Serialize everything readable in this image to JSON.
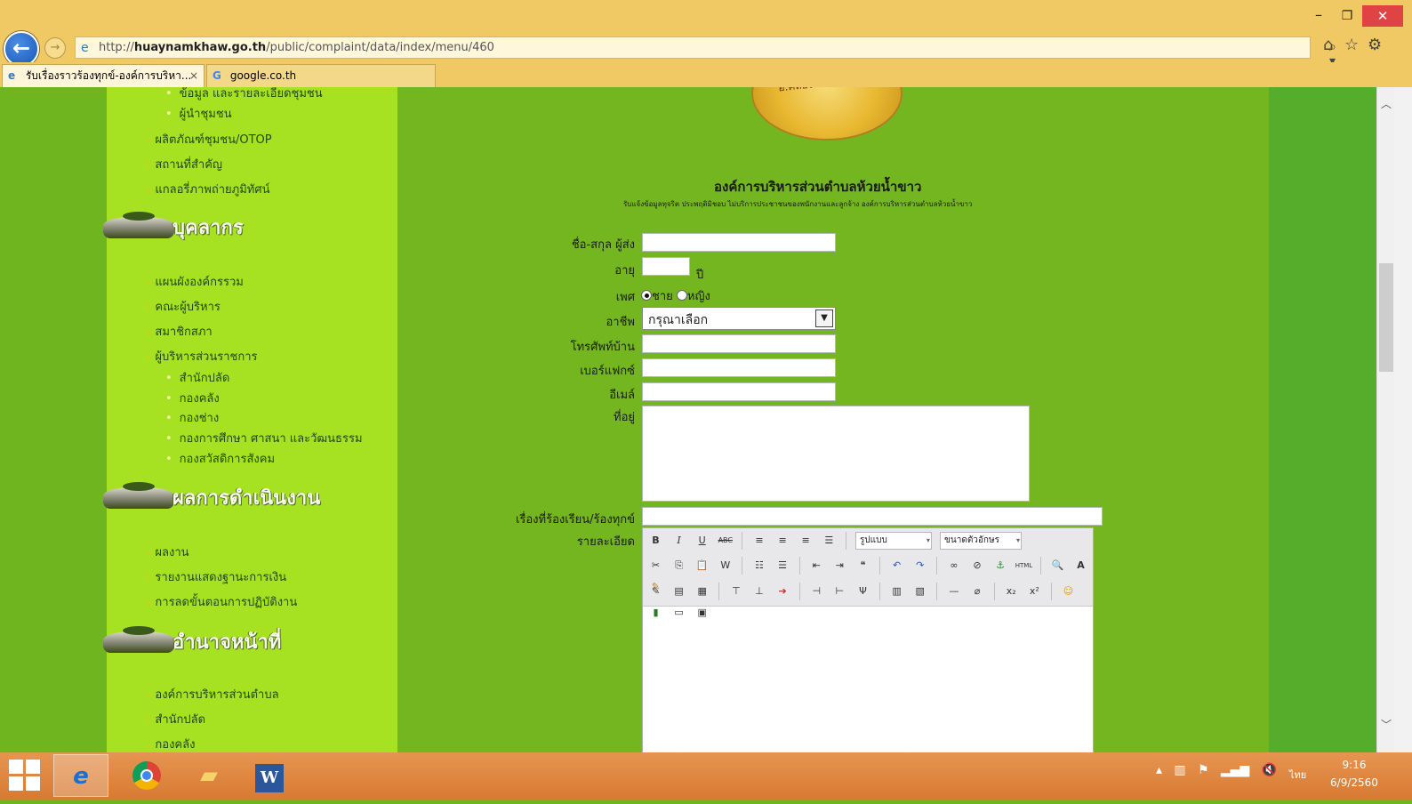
{
  "browser": {
    "url_prefix": "http://",
    "url_domain": "huaynamkhaw.go.th",
    "url_path": "/public/complaint/data/index/menu/460",
    "tabs": [
      {
        "label": "รับเรื่องราวร้องทุกข์-องค์การบริหา..."
      },
      {
        "label": "google.co.th"
      }
    ],
    "close_symbol": "×"
  },
  "sidebar": {
    "top_items": [
      "ข้อมูล และรายละเอียดชุมชน",
      "ผู้นำชุมชน"
    ],
    "group1": [
      "ผลิตภัณฑ์ชุมชน/OTOP",
      "สถานที่สำคัญ",
      "แกลอรี่ภาพถ่ายภูมิทัศน์"
    ],
    "header_personnel": "บุคลากร",
    "personnel": [
      "แผนผังองค์กรรวม",
      "คณะผู้บริหาร",
      "สมาชิกสภา",
      "ผู้บริหารส่วนราชการ"
    ],
    "personnel_sub": [
      "สำนักปลัด",
      "กองคลัง",
      "กองช่าง",
      "กองการศึกษา ศาสนา และวัฒนธรรม",
      "กองสวัสดิการสังคม"
    ],
    "header_results": "ผลการดำเนินงาน",
    "results": [
      "ผลงาน",
      "รายงานแสดงฐานะการเงิน",
      "การลดขั้นตอนการปฏิบัติงาน"
    ],
    "header_authority": "อำนาจหน้าที่",
    "authority": [
      "องค์การบริหารส่วนตำบล",
      "สำนักปลัด",
      "กองคลัง"
    ]
  },
  "content": {
    "seal_text": "อ.คลองท่อม จ.กระบี่",
    "title": "องค์การบริหารส่วนตำบลห้วยน้ำขาว",
    "subtitle": "รับแจ้งข้อมูลทุจริต ประพฤติมิชอบ ไม่บริการประชาชนของพนักงานและลูกจ้าง องค์การบริหารส่วนตำบลห้วยน้ำขาว",
    "form": {
      "name_label": "ชื่อ-สกุล ผู้ส่ง",
      "age_label": "อายุ",
      "age_unit": "ปี",
      "gender_label": "เพศ",
      "gender_male": "ชาย",
      "gender_female": "หญิง",
      "occupation_label": "อาชีพ",
      "occupation_value": "กรุณาเลือก",
      "phone_label": "โทรศัพท์บ้าน",
      "fax_label": "เบอร์แฟกซ์",
      "email_label": "อีเมล์",
      "address_label": "ที่อยู่",
      "subject_label": "เรื่องที่ร้องเรียน/ร้องทุกข์",
      "detail_label": "รายละเอียด"
    },
    "editor": {
      "style_combo": "รูปแบบ",
      "size_combo": "ขนาดตัวอักษร"
    }
  },
  "taskbar": {
    "ime": "ไทย",
    "time": "9:16",
    "date": "6/9/2560"
  }
}
